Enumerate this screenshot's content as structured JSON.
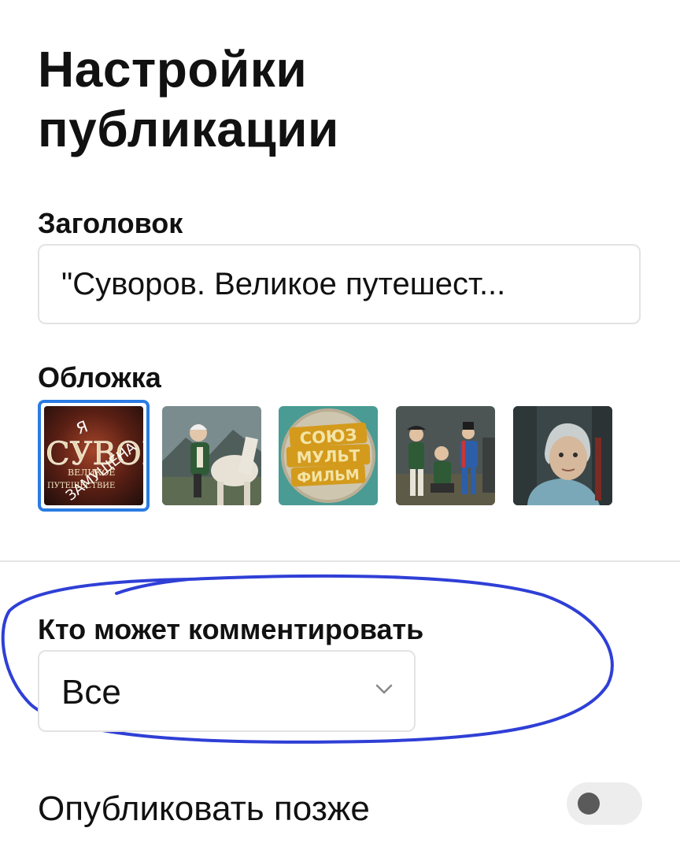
{
  "page": {
    "title": "Настройки публикации"
  },
  "title_section": {
    "label": "Заголовок",
    "value": "\"Суворов. Великое путешест..."
  },
  "cover_section": {
    "label": "Обложка",
    "selected_index": 0,
    "thumbnails": [
      {
        "overlay_lines": [
          "Я",
          "СУВОРО",
          "ЗАМУЩЕНА",
          "ВЕЛИКОЕ",
          "ПУТЕШЕСТВИЕ"
        ]
      },
      {
        "overlay_lines": []
      },
      {
        "overlay_lines": [
          "СОЮЗ",
          "МУЛЬТ",
          "ФИЛЬМ"
        ]
      },
      {
        "overlay_lines": []
      },
      {
        "overlay_lines": []
      }
    ]
  },
  "comments_section": {
    "label": "Кто может комментировать",
    "selected_option": "Все",
    "icon": "chevron-down-icon"
  },
  "publish_later": {
    "label": "Опубликовать позже",
    "enabled": false
  },
  "colors": {
    "selection_border": "#2a7be4",
    "annotation_stroke": "#2f3fd6"
  }
}
